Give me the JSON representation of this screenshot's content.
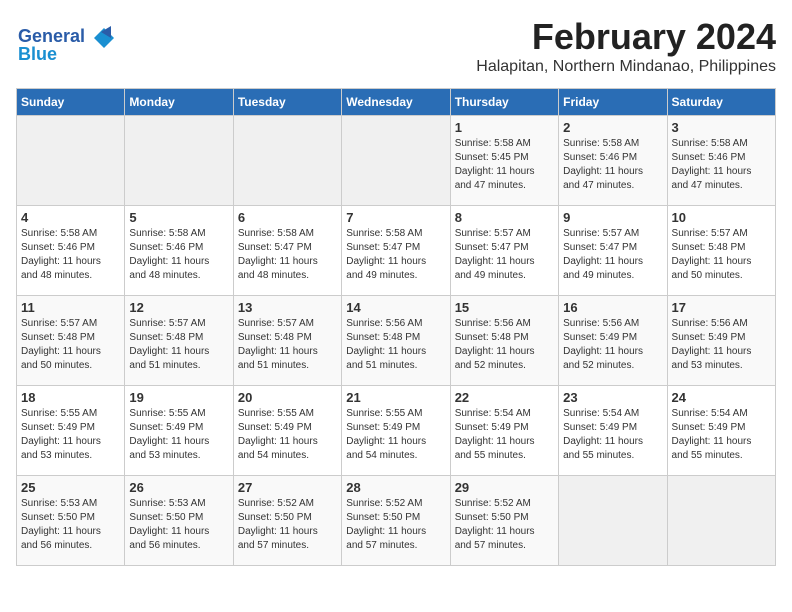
{
  "logo": {
    "line1": "General",
    "line2": "Blue"
  },
  "header": {
    "month_year": "February 2024",
    "location": "Halapitan, Northern Mindanao, Philippines"
  },
  "days_of_week": [
    "Sunday",
    "Monday",
    "Tuesday",
    "Wednesday",
    "Thursday",
    "Friday",
    "Saturday"
  ],
  "weeks": [
    [
      {
        "day": "",
        "info": ""
      },
      {
        "day": "",
        "info": ""
      },
      {
        "day": "",
        "info": ""
      },
      {
        "day": "",
        "info": ""
      },
      {
        "day": "1",
        "info": "Sunrise: 5:58 AM\nSunset: 5:45 PM\nDaylight: 11 hours\nand 47 minutes."
      },
      {
        "day": "2",
        "info": "Sunrise: 5:58 AM\nSunset: 5:46 PM\nDaylight: 11 hours\nand 47 minutes."
      },
      {
        "day": "3",
        "info": "Sunrise: 5:58 AM\nSunset: 5:46 PM\nDaylight: 11 hours\nand 47 minutes."
      }
    ],
    [
      {
        "day": "4",
        "info": "Sunrise: 5:58 AM\nSunset: 5:46 PM\nDaylight: 11 hours\nand 48 minutes."
      },
      {
        "day": "5",
        "info": "Sunrise: 5:58 AM\nSunset: 5:46 PM\nDaylight: 11 hours\nand 48 minutes."
      },
      {
        "day": "6",
        "info": "Sunrise: 5:58 AM\nSunset: 5:47 PM\nDaylight: 11 hours\nand 48 minutes."
      },
      {
        "day": "7",
        "info": "Sunrise: 5:58 AM\nSunset: 5:47 PM\nDaylight: 11 hours\nand 49 minutes."
      },
      {
        "day": "8",
        "info": "Sunrise: 5:57 AM\nSunset: 5:47 PM\nDaylight: 11 hours\nand 49 minutes."
      },
      {
        "day": "9",
        "info": "Sunrise: 5:57 AM\nSunset: 5:47 PM\nDaylight: 11 hours\nand 49 minutes."
      },
      {
        "day": "10",
        "info": "Sunrise: 5:57 AM\nSunset: 5:48 PM\nDaylight: 11 hours\nand 50 minutes."
      }
    ],
    [
      {
        "day": "11",
        "info": "Sunrise: 5:57 AM\nSunset: 5:48 PM\nDaylight: 11 hours\nand 50 minutes."
      },
      {
        "day": "12",
        "info": "Sunrise: 5:57 AM\nSunset: 5:48 PM\nDaylight: 11 hours\nand 51 minutes."
      },
      {
        "day": "13",
        "info": "Sunrise: 5:57 AM\nSunset: 5:48 PM\nDaylight: 11 hours\nand 51 minutes."
      },
      {
        "day": "14",
        "info": "Sunrise: 5:56 AM\nSunset: 5:48 PM\nDaylight: 11 hours\nand 51 minutes."
      },
      {
        "day": "15",
        "info": "Sunrise: 5:56 AM\nSunset: 5:48 PM\nDaylight: 11 hours\nand 52 minutes."
      },
      {
        "day": "16",
        "info": "Sunrise: 5:56 AM\nSunset: 5:49 PM\nDaylight: 11 hours\nand 52 minutes."
      },
      {
        "day": "17",
        "info": "Sunrise: 5:56 AM\nSunset: 5:49 PM\nDaylight: 11 hours\nand 53 minutes."
      }
    ],
    [
      {
        "day": "18",
        "info": "Sunrise: 5:55 AM\nSunset: 5:49 PM\nDaylight: 11 hours\nand 53 minutes."
      },
      {
        "day": "19",
        "info": "Sunrise: 5:55 AM\nSunset: 5:49 PM\nDaylight: 11 hours\nand 53 minutes."
      },
      {
        "day": "20",
        "info": "Sunrise: 5:55 AM\nSunset: 5:49 PM\nDaylight: 11 hours\nand 54 minutes."
      },
      {
        "day": "21",
        "info": "Sunrise: 5:55 AM\nSunset: 5:49 PM\nDaylight: 11 hours\nand 54 minutes."
      },
      {
        "day": "22",
        "info": "Sunrise: 5:54 AM\nSunset: 5:49 PM\nDaylight: 11 hours\nand 55 minutes."
      },
      {
        "day": "23",
        "info": "Sunrise: 5:54 AM\nSunset: 5:49 PM\nDaylight: 11 hours\nand 55 minutes."
      },
      {
        "day": "24",
        "info": "Sunrise: 5:54 AM\nSunset: 5:49 PM\nDaylight: 11 hours\nand 55 minutes."
      }
    ],
    [
      {
        "day": "25",
        "info": "Sunrise: 5:53 AM\nSunset: 5:50 PM\nDaylight: 11 hours\nand 56 minutes."
      },
      {
        "day": "26",
        "info": "Sunrise: 5:53 AM\nSunset: 5:50 PM\nDaylight: 11 hours\nand 56 minutes."
      },
      {
        "day": "27",
        "info": "Sunrise: 5:52 AM\nSunset: 5:50 PM\nDaylight: 11 hours\nand 57 minutes."
      },
      {
        "day": "28",
        "info": "Sunrise: 5:52 AM\nSunset: 5:50 PM\nDaylight: 11 hours\nand 57 minutes."
      },
      {
        "day": "29",
        "info": "Sunrise: 5:52 AM\nSunset: 5:50 PM\nDaylight: 11 hours\nand 57 minutes."
      },
      {
        "day": "",
        "info": ""
      },
      {
        "day": "",
        "info": ""
      }
    ]
  ]
}
